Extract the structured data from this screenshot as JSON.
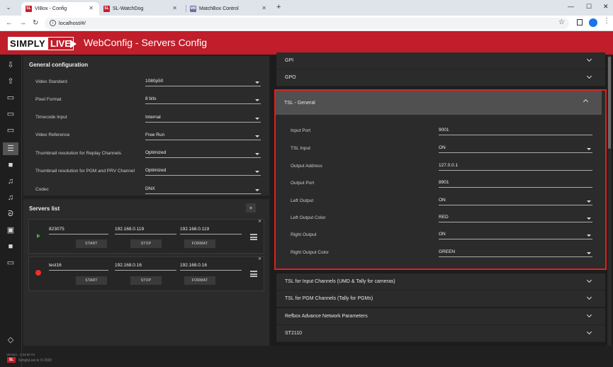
{
  "browser": {
    "tabs": [
      {
        "label": "VIBox - Config",
        "favicon": "SL"
      },
      {
        "label": "SL-WatchDog",
        "favicon": "SL"
      },
      {
        "label": "MatchBox Control",
        "favicon": "MB"
      }
    ],
    "url": "localhost/#/"
  },
  "app": {
    "logo_simply": "SIMPLY",
    "logo_live": "LIVE",
    "title": "WebConfig - Servers Config",
    "version": "Version : 1.33.90 #4",
    "badge": "SL",
    "copyright": "SimplyLive.tv © 2020"
  },
  "general": {
    "title": "General configuration",
    "rows": [
      {
        "label": "Video Standard",
        "value": "1080p50"
      },
      {
        "label": "Pixel Format",
        "value": "8 bits"
      },
      {
        "label": "Timecode Input",
        "value": "Internal"
      },
      {
        "label": "Video Reference",
        "value": "Free Run"
      },
      {
        "label": "Thumbnail resolution for Replay Channels",
        "value": "Optimized"
      },
      {
        "label": "Thumbnail resolution for PGM and PRV Channel",
        "value": "Optimized"
      },
      {
        "label": "Codec",
        "value": "DNX"
      }
    ]
  },
  "servers": {
    "title": "Servers list",
    "add_label": "+",
    "items": [
      {
        "name": "823075",
        "ip1": "192.168.0.119",
        "ip2": "192.168.0.119",
        "start": "START",
        "stop": "STOP",
        "format": "FORMAT",
        "status": "playing"
      },
      {
        "name": "test16",
        "ip1": "192.168.0.16",
        "ip2": "192.168.0.16",
        "start": "START",
        "stop": "STOP",
        "format": "FORMAT",
        "status": "recording"
      }
    ]
  },
  "right": {
    "sections_top": [
      "GPI",
      "GPO"
    ],
    "tsl_general": {
      "title": "TSL - General",
      "rows": [
        {
          "label": "Input Port",
          "value": "9001",
          "dropdown": false
        },
        {
          "label": "TSL Input",
          "value": "ON",
          "dropdown": true
        },
        {
          "label": "Output Address",
          "value": "127.0.0.1",
          "dropdown": false
        },
        {
          "label": "Output Port",
          "value": "8901",
          "dropdown": false
        },
        {
          "label": "Left Output",
          "value": "ON",
          "dropdown": true
        },
        {
          "label": "Left Output Color",
          "value": "RED",
          "dropdown": true
        },
        {
          "label": "Right Output",
          "value": "ON",
          "dropdown": true
        },
        {
          "label": "Right Output Color",
          "value": "GREEN",
          "dropdown": true
        }
      ]
    },
    "sections_bottom": [
      "TSL for Input Channels (UMD & Tally for cameras)",
      "TSL for PGM Channels (Tally for PGMs)",
      "Refbox Advance Network Parameters",
      "ST2110"
    ]
  },
  "colors": {
    "brand": "#c01e2a",
    "highlight": "#e02020",
    "bg": "#202020"
  }
}
